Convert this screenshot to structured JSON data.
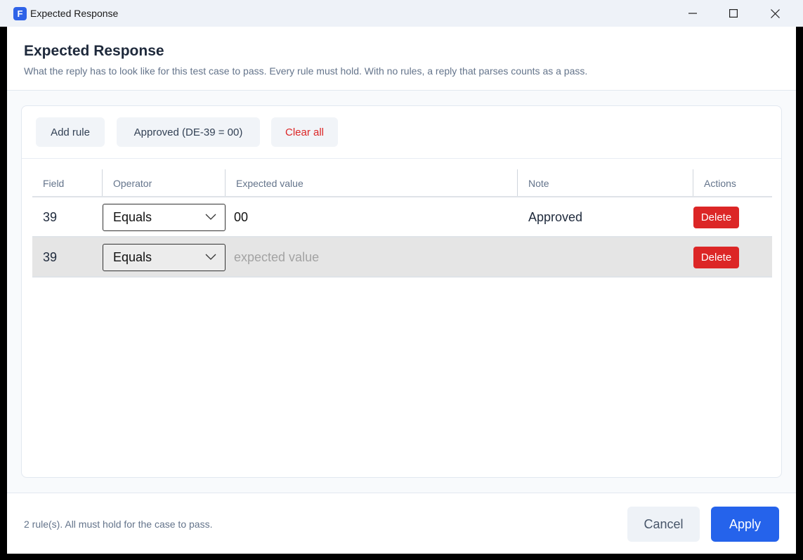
{
  "window": {
    "title": "Expected Response",
    "app_icon_letter": "F",
    "controls": [
      "minimize-icon",
      "maximize-icon",
      "close-icon"
    ]
  },
  "dialog": {
    "heading": "Expected Response",
    "subheading": "What the reply has to look like for this test case to pass. Every rule must hold. With no rules, a reply that parses counts as a pass."
  },
  "toolbar": {
    "add_rule": "Add rule",
    "preset_approved": "Approved (DE-39 = 00)",
    "clear_all": "Clear all"
  },
  "table": {
    "headers": {
      "field": "Field",
      "operator": "Operator",
      "expected_value": "Expected value",
      "note": "Note",
      "actions": "Actions"
    },
    "rows": [
      {
        "field": "39",
        "operator": "Equals",
        "expected_value": "00",
        "placeholder": "",
        "note": "Approved",
        "action": "Delete",
        "selected": false
      },
      {
        "field": "39",
        "operator": "Equals",
        "expected_value": "",
        "placeholder": "expected value",
        "note": "",
        "action": "Delete",
        "selected": true
      }
    ]
  },
  "footer": {
    "status": "2 rule(s). All must hold for the case to pass.",
    "cancel": "Cancel",
    "apply": "Apply"
  },
  "colors": {
    "accent": "#2563eb",
    "danger": "#dc2626",
    "app_icon": "#2f63e8"
  }
}
